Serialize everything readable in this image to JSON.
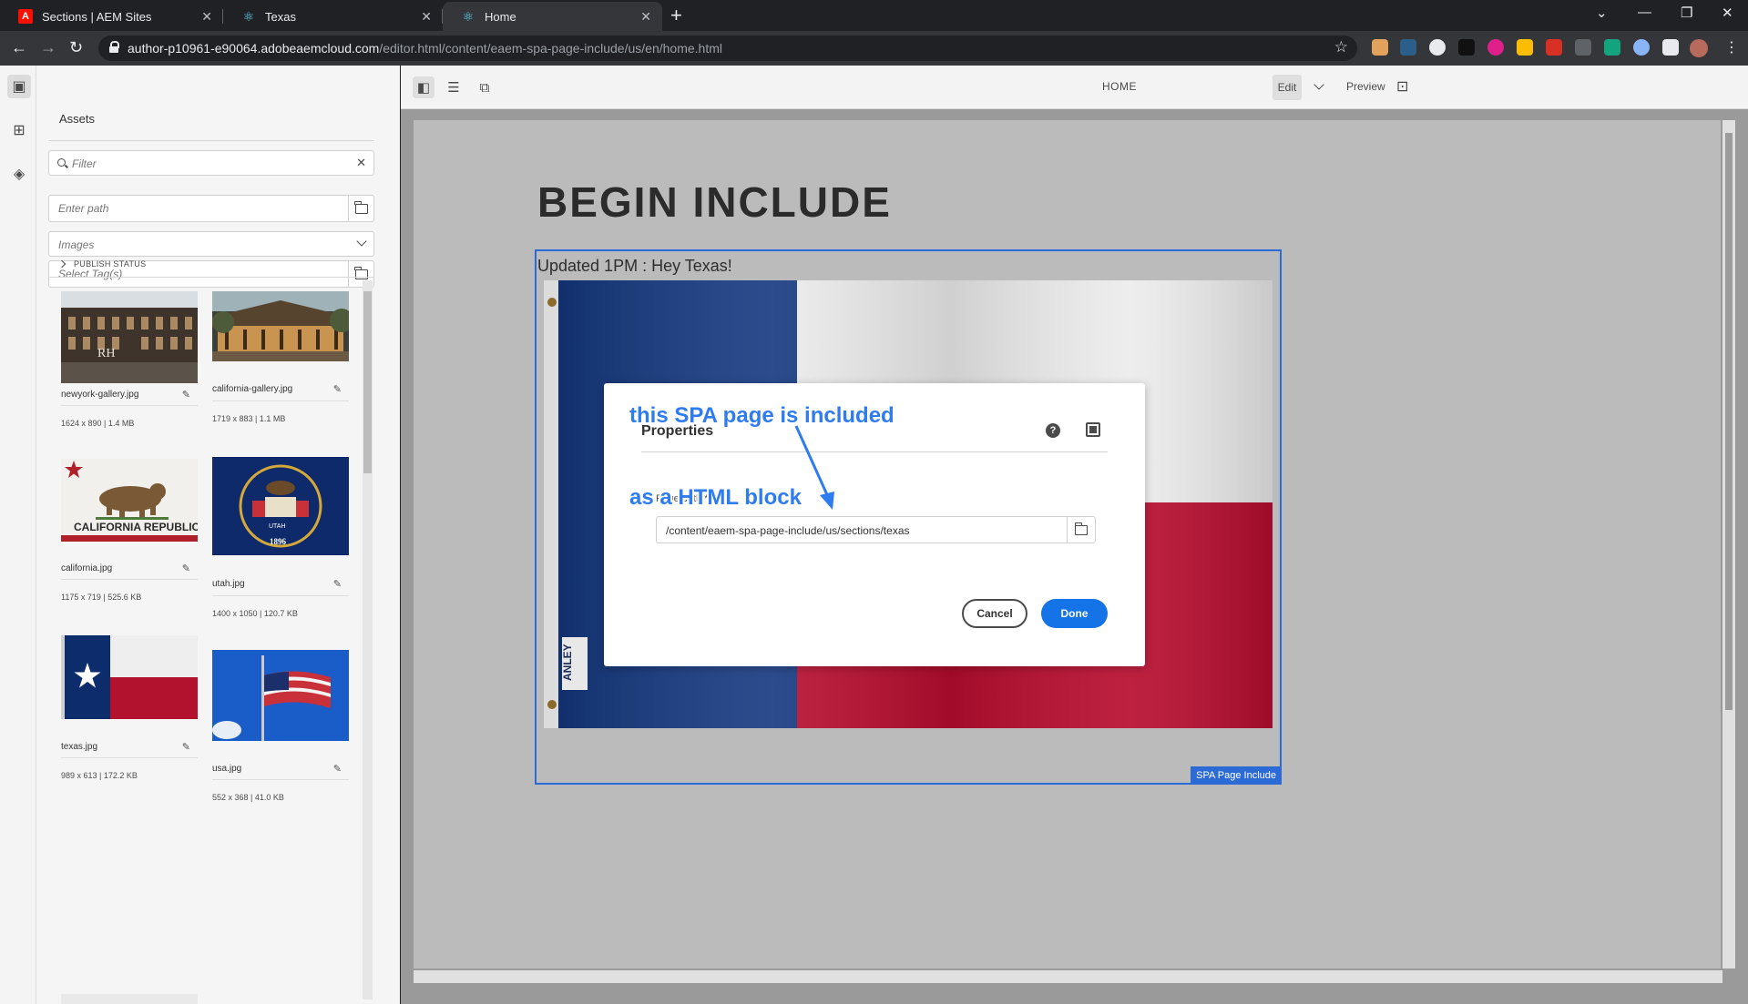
{
  "browser": {
    "tabs": [
      {
        "title": "Sections | AEM Sites",
        "favicon": "adobe-icon"
      },
      {
        "title": "Texas",
        "favicon": "react-icon"
      },
      {
        "title": "Home",
        "favicon": "react-icon",
        "active": true
      }
    ],
    "url_host": "author-p10961-e90064.adobeaemcloud.com",
    "url_path": "/editor.html/content/eaem-spa-page-include/us/en/home.html"
  },
  "assets_panel": {
    "title": "Assets",
    "filter_placeholder": "Filter",
    "path_placeholder": "Enter path",
    "type_value": "Images",
    "tags_placeholder": "Select Tag(s)",
    "publish_status": "PUBLISH STATUS",
    "assets": [
      {
        "name": "newyork-gallery.jpg",
        "meta": "1624 x 890 | 1.4 MB"
      },
      {
        "name": "california-gallery.jpg",
        "meta": "1719 x 883 | 1.1 MB"
      },
      {
        "name": "california.jpg",
        "meta": "1175 x 719 | 525.6 KB"
      },
      {
        "name": "utah.jpg",
        "meta": "1400 x 1050 | 120.7 KB"
      },
      {
        "name": "texas.jpg",
        "meta": "989 x 613 | 172.2 KB"
      },
      {
        "name": "usa.jpg",
        "meta": "552 x 368 | 41.0 KB"
      }
    ]
  },
  "editor": {
    "page_name": "HOME",
    "mode": "Edit",
    "preview": "Preview",
    "page_heading": "BEGIN INCLUDE",
    "include_text": "Updated 1PM : Hey Texas!",
    "include_tag": "SPA Page Include"
  },
  "dialog": {
    "title": "Properties",
    "field_label": "Page path *",
    "field_value": "/content/eaem-spa-page-include/us/sections/texas",
    "cancel": "Cancel",
    "done": "Done"
  },
  "annotation": {
    "line1": "this SPA page is included",
    "line2": "as a HTML block"
  },
  "colors": {
    "accent": "#1473e6",
    "include_border": "#2c6bd6",
    "annotation": "#2f7bf0"
  }
}
